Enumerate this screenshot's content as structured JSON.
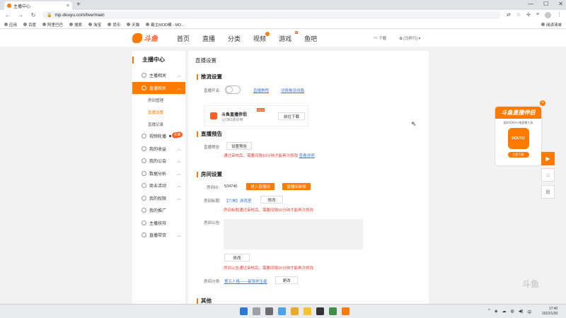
{
  "browser": {
    "tab_title": "主播中心",
    "url": "mp.douyu.com/live/main",
    "bookmarks": [
      "应用",
      "百度",
      "阿里巴巴",
      "搜索",
      "淘宝",
      "货币",
      "天猫",
      "霸主MOD模 - MO..."
    ],
    "reading_list": "阅读清单"
  },
  "header": {
    "logo_text": "斗鱼",
    "nav": [
      "首页",
      "直播",
      "分类",
      "视频",
      "游戏",
      "鱼吧"
    ],
    "download": "下载",
    "user": "[马桥行]"
  },
  "sidebar": {
    "title": "主播中心",
    "items": {
      "anchor": "主播相关",
      "live": "直播相关",
      "live_sub": [
        "房间管理",
        "直播设置",
        "直播记录"
      ],
      "video": "视频轮播",
      "video_tag": "开通",
      "income": "我的收益",
      "guild": "我的公会",
      "data": "数据分析",
      "business": "商业活动",
      "rights": "我的权限",
      "promo": "我的推广",
      "support": "主播扶持",
      "goods": "直播带货"
    }
  },
  "main": {
    "page_title": "直播设置",
    "stream": {
      "title": "推流设置",
      "switch_label": "直播开关:",
      "link_tutorial": "直播教程",
      "link_switch_line": "切换推流线路",
      "promo_title": "斗鱼直播伴侣",
      "promo_sub": "让OBS更好用",
      "promo_new": "NEW",
      "promo_btn": "前往下载"
    },
    "preview": {
      "title": "直播预告",
      "label": "直播预告:",
      "btn": "设置预告",
      "warn": "通过审核后，需要间隔10分钟才能再次修改",
      "warn_link": "查看说明"
    },
    "room": {
      "title": "房间设置",
      "id_label": "房间ID:",
      "id_value": "534740",
      "btn_enter": "进入直播间",
      "btn_manage": "直播间装修",
      "title_label": "房间标题:",
      "title_value": "【六神】游戏室",
      "title_edit": "修改",
      "title_warn": "房间标题通过审核后，需要间隔10分钟才能再次修改",
      "notice_label": "房间公告:",
      "notice_edit": "修改",
      "notice_warn": "房间公告通过审核后，需要间隔10分钟才能再次修改",
      "category_label": "房间分类:",
      "category_value": "第五人格——最强求生者",
      "category_edit": "更改"
    },
    "other": {
      "title": "其他"
    }
  },
  "ad": {
    "title": "斗鱼直播伴侣",
    "subtitle": "超好用的PC端直播工具",
    "image_text": "DOUYU",
    "btn": "立即下载"
  },
  "watermark": "斗鱼",
  "taskbar": {
    "time": "17:40",
    "date": "2022/1/30"
  },
  "colors": {
    "accent": "#ff7a00",
    "warn": "#e8453c",
    "link": "#3a7bd5"
  }
}
